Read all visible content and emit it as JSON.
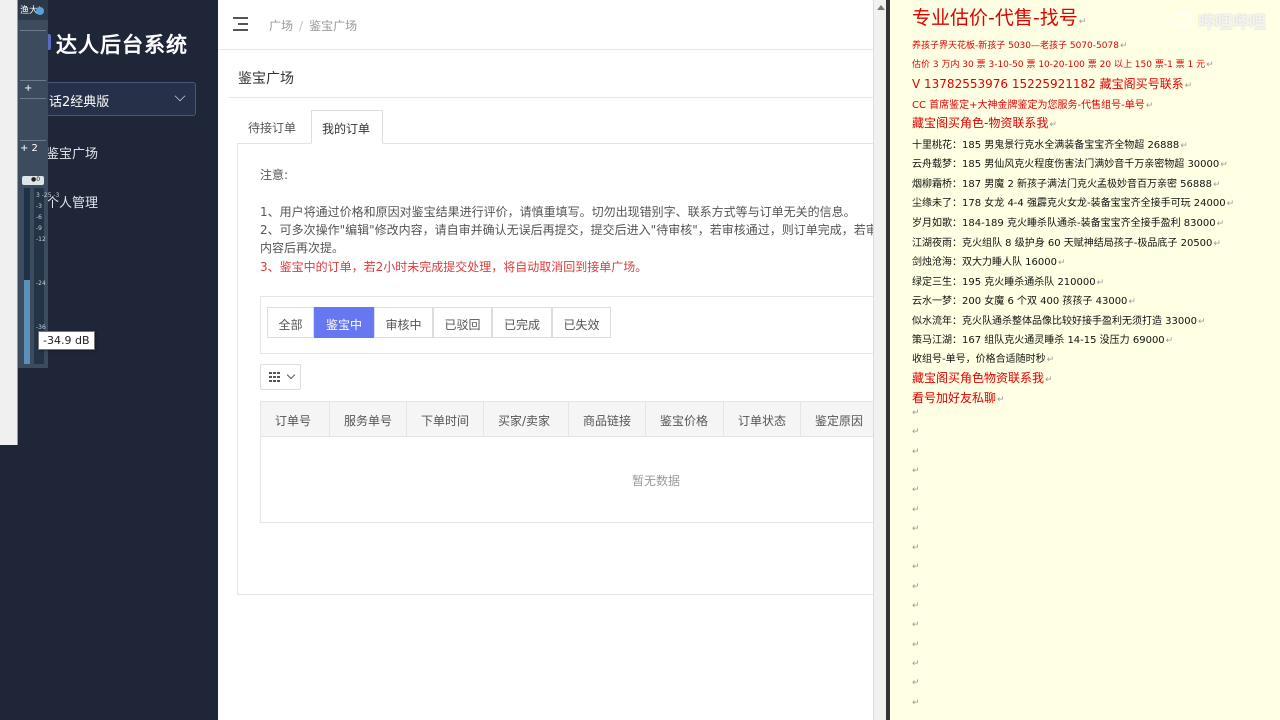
{
  "sidebar": {
    "brand": "达人后台系统",
    "selector": "话2经典版",
    "items": [
      {
        "label": "鉴宝广场"
      },
      {
        "label": "个人管理"
      }
    ]
  },
  "mixer": {
    "top_label": "渔大I",
    "plus_a": "+",
    "plus_b": "+ 2",
    "toggle_label": "●0",
    "ticks": [
      "3 -25 -3",
      "-3",
      "-6",
      "-9",
      "-12",
      "",
      "",
      "",
      "-24",
      "",
      "",
      "",
      "-36"
    ],
    "db_readout": "-34.9 dB"
  },
  "header": {
    "breadcrumb": [
      "广场",
      "鉴宝广场"
    ],
    "page_title": "鉴宝广场"
  },
  "tabs": [
    {
      "label": "待接订单",
      "active": false
    },
    {
      "label": "我的订单",
      "active": true
    }
  ],
  "notice": {
    "title": "注意:",
    "lines": [
      "1、用户将通过价格和原因对鉴宝结果进行评价，请慎重填写。切勿出现错别字、联系方式等与订单无关的信息。",
      "2、可多次操作\"编辑\"修改内容，请自审并确认无误后再提交，提交后进入\"待审核\"，若审核通过，则订单完成，若审",
      "内容后再次提。"
    ],
    "warning": "3、鉴宝中的订单，若2小时未完成提交处理，将自动取消回到接单广场。"
  },
  "filters": [
    {
      "label": "全部",
      "active": false
    },
    {
      "label": "鉴宝中",
      "active": true
    },
    {
      "label": "审核中",
      "active": false
    },
    {
      "label": "已驳回",
      "active": false
    },
    {
      "label": "已完成",
      "active": false
    },
    {
      "label": "已失效",
      "active": false
    }
  ],
  "table": {
    "columns": [
      "订单号",
      "服务单号",
      "下单时间",
      "买家/卖家",
      "商品链接",
      "鉴宝价格",
      "订单状态",
      "鉴定原因"
    ],
    "empty_text": "暂无数据"
  },
  "notes": {
    "lines": [
      "专业估价-代售-找号",
      "养孩子界天花板-新孩子 5030—老孩子 5070-5078",
      "估价 3 万内 30 票  3-10-50 票  10-20-100 票  20 以上 150 票-1 票 1 元",
      "V 13782553976    15225921182   藏宝阁买号联系",
      "CC 首席鉴定+大神金牌鉴定为您服务-代售组号-单号",
      "藏宝阁买角色-物资联系我",
      "十里桃花：185 男鬼景行克水全满装备宝宝齐全物超 26888",
      "云舟载梦：185 男仙风克火程度伤害法门满妙音千万亲密物超 30000",
      "烟柳霜桥：187 男魔 2 新孩子满法门克火孟极妙音百万亲密 56888",
      "尘缘未了：178 女龙 4-4 强霹克火女龙-装备宝宝齐全接手可玩 24000",
      "岁月如歌：184-189 克火睡杀队通杀-装备宝宝齐全接手盈利 83000",
      "江湖夜雨：克火组队 8 级护身 60 天赋神结局孩子-极品底子 20500",
      "剑烛沧海：双大力睡人队 16000",
      "绿定三生：195 克火睡杀通杀队 210000",
      "云水一梦：200 女魔 6 个双 400 孩孩子 43000",
      "似水流年：克火队通杀整体品像比较好接手盈利无须打造 33000",
      "策马江湖：167 组队克火通灵睡杀 14-15 没压力 69000",
      "收组号-单号，价格合适随时秒",
      "藏宝阁买角色物资联系我",
      "看号加好友私聊"
    ],
    "para_mark": "↵",
    "watermark": "哔哩哔哩"
  }
}
